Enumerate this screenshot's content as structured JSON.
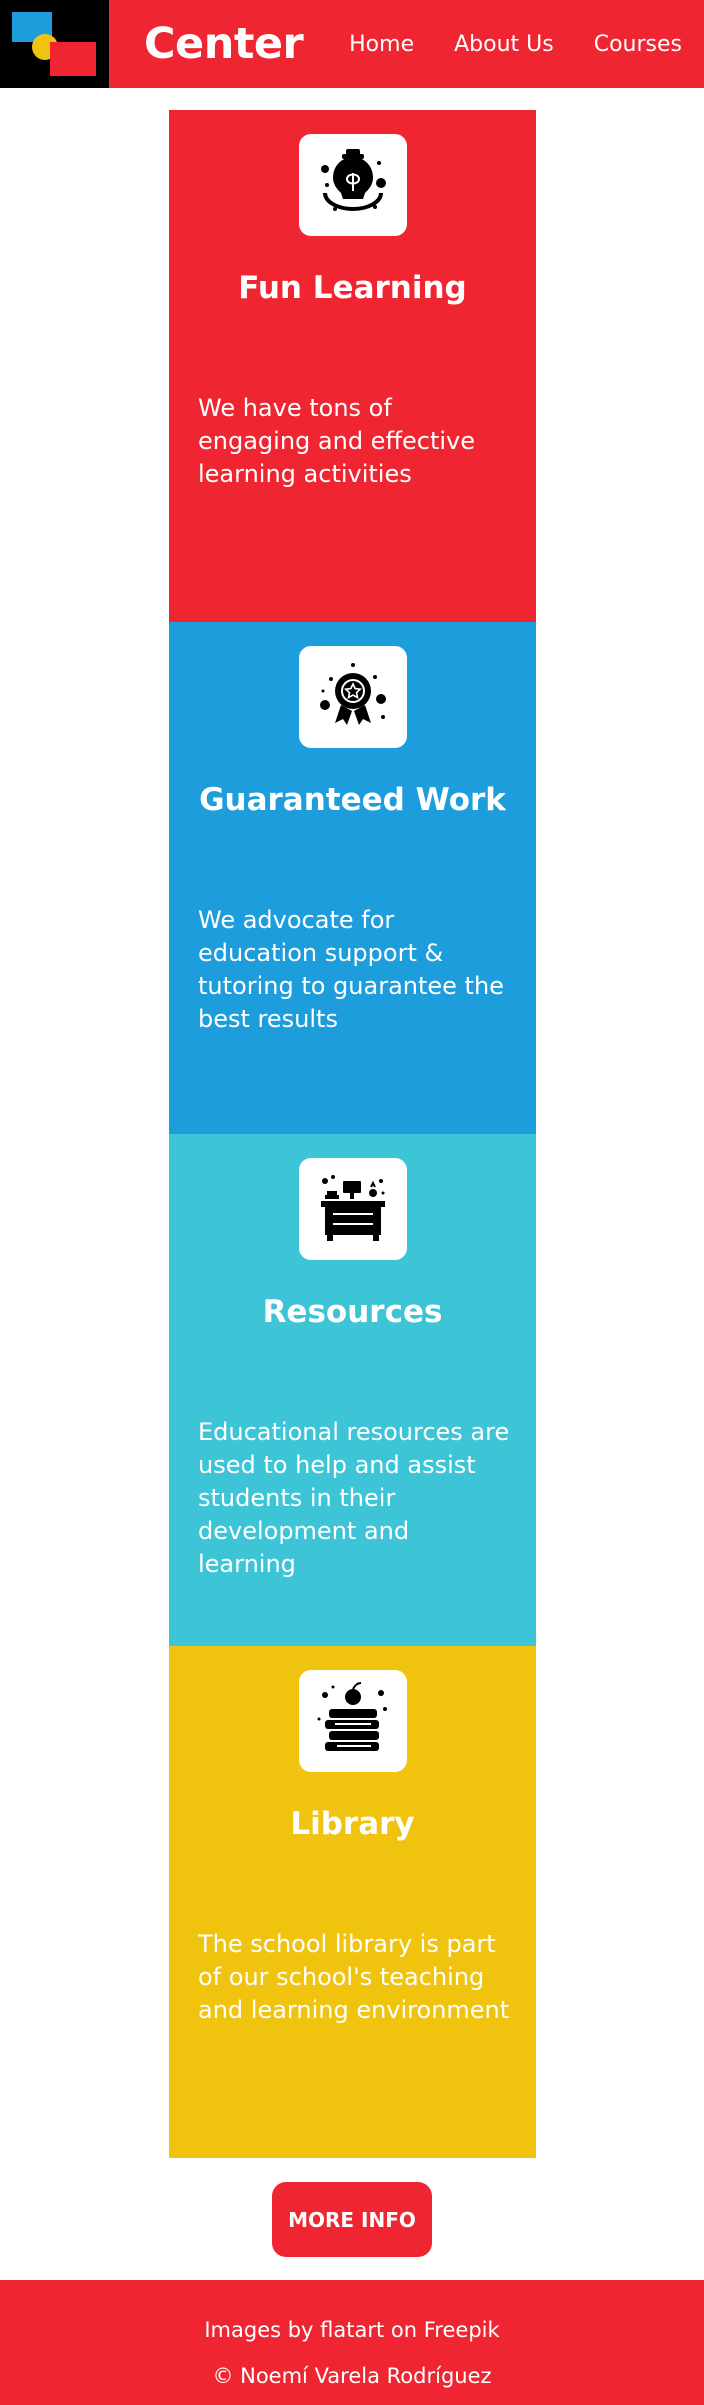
{
  "colors": {
    "red": "#ef2531",
    "blue": "#1d9ddc",
    "cyan": "#3dc5d7",
    "yellow": "#f0c30f",
    "black": "#000000",
    "white": "#ffffff"
  },
  "header": {
    "brand": "Center",
    "nav": [
      {
        "label": "Home"
      },
      {
        "label": "About Us"
      },
      {
        "label": "Courses"
      }
    ]
  },
  "cards": [
    {
      "icon": "lightbulb-icon",
      "title": "Fun Learning",
      "text": "We have tons of engaging and effective learning activities",
      "color": "#ef2531"
    },
    {
      "icon": "award-badge-icon",
      "title": "Guaranteed Work",
      "text": "We advocate for education support & tutoring to guarantee the best results",
      "color": "#1d9ddc"
    },
    {
      "icon": "school-desk-icon",
      "title": "Resources",
      "text": "Educational resources are used to help and assist students in their development and learning",
      "color": "#3dc5d7"
    },
    {
      "icon": "book-stack-icon",
      "title": "Library",
      "text": "The school library is part of our school's teaching and learning environment",
      "color": "#f0c30f"
    }
  ],
  "more_button": "MORE INFO",
  "footer": {
    "credit_prefix": "Images by ",
    "credit_link": "flatart",
    "credit_suffix": " on Freepik",
    "copyright": "© Noemí Varela Rodríguez"
  }
}
